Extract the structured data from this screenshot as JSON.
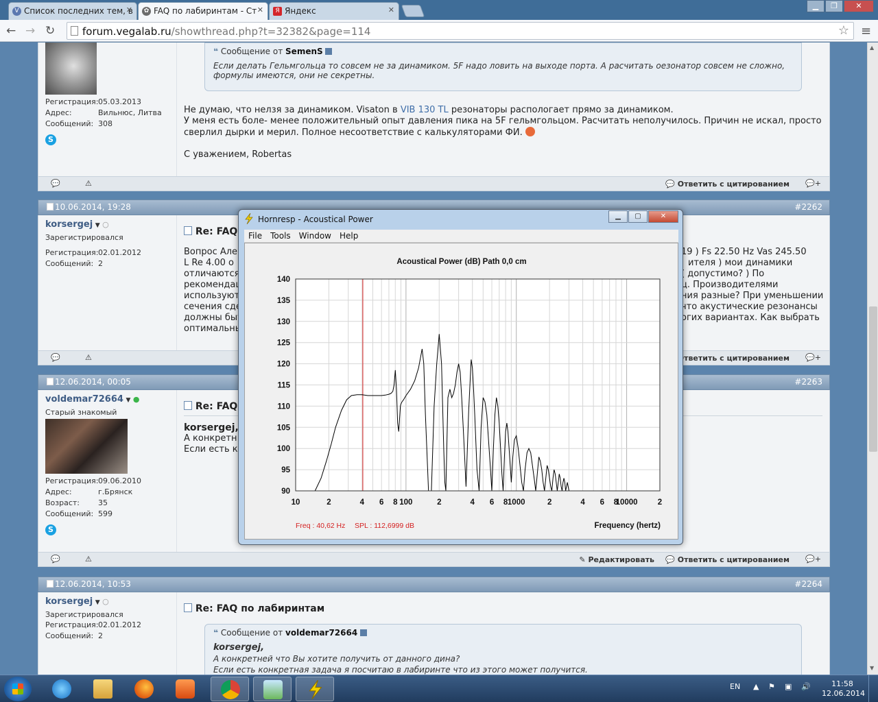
{
  "browser": {
    "tabs": [
      {
        "label": "Список последних тем, в",
        "active": false
      },
      {
        "label": "FAQ по лабиринтам - Ст",
        "active": true
      },
      {
        "label": "Яндекс",
        "active": false
      }
    ],
    "url_domain": "forum.vegalab.ru",
    "url_path": "/showthread.php?t=32382&page=114"
  },
  "posts": [
    {
      "id": "p0",
      "user": {
        "reg_label": "Регистрация:",
        "reg": "05.03.2013",
        "addr_label": "Адрес:",
        "addr": "Вильнюс, Литва",
        "msgs_label": "Сообщений:",
        "msgs": "308"
      },
      "quote": {
        "from_prefix": "Сообщение от",
        "author": "SemenS",
        "text": "Если делать Гельмгольца то совсем не за динамиком. 5F надо ловить на выходе порта. А расчитать оезонатор совсем не сложно, формулы имеются, они не секретны."
      },
      "body_line1_a": "Не думаю, что нелзя за динамиком. Visaton в ",
      "body_line1_link": "VIB 130 TL",
      "body_line1_b": " резонаторы распологает прямо за динамиком.",
      "body_line2": "У меня есть боле- менее положительный опыт давления пика на 5F гельмгольцом. Расчитать неполучилось. Причин не искал, просто сверлил дырки и мерил. Полное несоответствие с калькуляторами ФИ.",
      "signature": "С уважением, Robertas",
      "reply_quote": "Ответить с цитированием"
    },
    {
      "id": "p1",
      "date": "10.06.2014, 19:28",
      "num": "#2262",
      "user": {
        "name": "korsergej",
        "title": "Зарегистрировался",
        "reg_label": "Регистрация:",
        "reg": "02.01.2012",
        "msgs_label": "Сообщений:",
        "msgs": "2"
      },
      "title": "Re: FAQ",
      "text_left": [
        "Вопрос Але",
        "L Re 4.00 о",
        "отличаются",
        "рекомендац",
        "используют",
        "сечения сде",
        "должны быт",
        "оптимальны"
      ],
      "text_right": [
        "19 ) Fs 22.50 Hz Vas 245.50",
        "ителя ) мои динамики",
        "( допустимо? ) По",
        "ц. Производителями",
        "ния разные? При уменьшении",
        "что акустические резонансы",
        "огих вариантах. Как выбрать"
      ],
      "reply_quote": "Ответить с цитированием"
    },
    {
      "id": "p2",
      "date": "12.06.2014, 00:05",
      "num": "#2263",
      "user": {
        "name": "voldemar72664",
        "title": "Старый знакомый",
        "reg_label": "Регистрация:",
        "reg": "09.06.2010",
        "addr_label": "Адрес:",
        "addr": "г.Брянск",
        "age_label": "Возраст:",
        "age": "35",
        "msgs_label": "Сообщений:",
        "msgs": "599"
      },
      "title": "Re: FAQ",
      "lines": [
        "korsergej,",
        "А конкретн",
        "Если есть к"
      ],
      "edit": "Редактировать",
      "reply_quote": "Ответить с цитированием"
    },
    {
      "id": "p3",
      "date": "12.06.2014, 10:53",
      "num": "#2264",
      "user": {
        "name": "korsergej",
        "title": "Зарегистрировался",
        "reg_label": "Регистрация:",
        "reg": "02.01.2012",
        "msgs_label": "Сообщений:",
        "msgs": "2"
      },
      "title": "Re: FAQ по лабиринтам",
      "quote": {
        "from_prefix": "Сообщение от",
        "author": "voldemar72664",
        "line1": "korsergej,",
        "line2": "А конкретней что Вы хотите получить от данного дина?",
        "line3": "Если есть конкретная задача я посчитаю в лабиринте что из этого может получится."
      }
    }
  ],
  "hornresp": {
    "window_title": "Hornresp - Acoustical Power",
    "menu": [
      "File",
      "Tools",
      "Window",
      "Help"
    ],
    "status_freq": "Freq : 40,62 Hz",
    "status_spl": "SPL : 112,6999 dB"
  },
  "chart_data": {
    "type": "line",
    "title": "Acoustical Power (dB)   Path 0,0 cm",
    "xlabel": "Frequency (hertz)",
    "ylabel": "",
    "x_scale": "log",
    "xlim": [
      10,
      20000
    ],
    "ylim": [
      90,
      140
    ],
    "y_ticks": [
      140,
      135,
      130,
      125,
      120,
      115,
      110,
      105,
      100,
      95,
      90
    ],
    "x_tick_labels": [
      {
        "f": 10,
        "label": "10"
      },
      {
        "f": 20,
        "label": "2"
      },
      {
        "f": 40,
        "label": "4"
      },
      {
        "f": 60,
        "label": "6"
      },
      {
        "f": 80,
        "label": "8"
      },
      {
        "f": 100,
        "label": "100"
      },
      {
        "f": 200,
        "label": "2"
      },
      {
        "f": 400,
        "label": "4"
      },
      {
        "f": 600,
        "label": "6"
      },
      {
        "f": 800,
        "label": "8"
      },
      {
        "f": 1000,
        "label": "1000"
      },
      {
        "f": 2000,
        "label": "2"
      },
      {
        "f": 4000,
        "label": "4"
      },
      {
        "f": 6000,
        "label": "6"
      },
      {
        "f": 8000,
        "label": "8"
      },
      {
        "f": 10000,
        "label": "10000"
      },
      {
        "f": 20000,
        "label": "2"
      }
    ],
    "marker_freq": 40.62,
    "grid": true,
    "series": [
      {
        "x": [
          15,
          17,
          19,
          21,
          23,
          26,
          29,
          32,
          36,
          40,
          45,
          50,
          55,
          60,
          65,
          70,
          73,
          76,
          78,
          80,
          82,
          84,
          86,
          88,
          89,
          90,
          92,
          95,
          100,
          110,
          120,
          130,
          140,
          145,
          150,
          160,
          170,
          180,
          190,
          200,
          210,
          215,
          220,
          225,
          230,
          240,
          250,
          260,
          270,
          280,
          290,
          300,
          310,
          320,
          330,
          340,
          350,
          370,
          390,
          400,
          410,
          420,
          440,
          460,
          480,
          500,
          520,
          540,
          560,
          580,
          600,
          620,
          640,
          660,
          680,
          700,
          720,
          740,
          760,
          780,
          800,
          820,
          840,
          860,
          880,
          900,
          930,
          960,
          1000,
          1040,
          1080,
          1120,
          1160,
          1200,
          1250,
          1300,
          1350,
          1400,
          1450,
          1500,
          1550,
          1600,
          1650,
          1700,
          1750,
          1800,
          1850,
          1900,
          1950,
          2000,
          2050,
          2100,
          2150,
          2200,
          2250,
          2300,
          2350,
          2400,
          2450,
          2500,
          2550,
          2600,
          2650,
          2700,
          2750,
          2800,
          2850,
          2900,
          2950,
          3000
        ],
        "y": [
          90,
          93,
          97,
          101,
          105,
          109,
          111.5,
          112.5,
          112.7,
          112.7,
          112.5,
          112.5,
          112.5,
          112.5,
          112.6,
          112.8,
          113,
          113.5,
          115,
          118.5,
          114,
          106,
          104,
          108,
          110,
          110.5,
          111,
          111.5,
          112.5,
          114,
          116,
          119,
          123.5,
          120,
          108,
          90,
          90,
          110,
          120,
          127,
          120,
          110,
          100,
          92,
          90,
          112,
          114,
          112,
          113,
          115,
          118,
          120,
          118,
          112,
          105,
          98,
          91,
          109,
          121,
          119,
          114,
          108,
          95,
          90,
          105,
          112,
          111,
          108,
          102,
          96,
          90,
          100,
          108,
          112,
          110,
          106,
          100,
          94,
          90,
          98,
          104,
          106,
          104,
          100,
          96,
          92,
          98,
          102,
          103,
          100,
          96,
          92,
          90,
          95,
          99,
          100,
          99,
          96,
          93,
          90,
          94,
          98,
          97,
          95,
          92,
          90,
          93,
          96,
          95,
          93,
          91,
          90,
          93,
          95,
          94,
          92,
          90,
          92,
          94,
          93,
          91,
          90,
          92,
          93,
          92,
          90,
          91,
          92,
          91,
          90
        ]
      }
    ]
  },
  "taskbar": {
    "lang": "EN",
    "time": "11:58",
    "date": "12.06.2014"
  }
}
